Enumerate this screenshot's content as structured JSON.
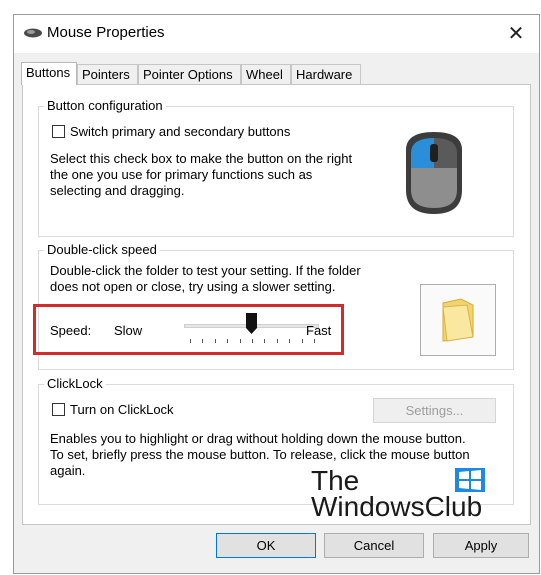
{
  "window": {
    "title": "Mouse Properties",
    "close_glyph": "✕"
  },
  "tabs": [
    {
      "label": "Buttons",
      "active": true
    },
    {
      "label": "Pointers"
    },
    {
      "label": "Pointer Options"
    },
    {
      "label": "Wheel"
    },
    {
      "label": "Hardware"
    }
  ],
  "button_config": {
    "legend": "Button configuration",
    "checkbox_label": "Switch primary and secondary buttons",
    "checked": false,
    "description_lines": [
      "Select this check box to make the button on the right",
      "the one you use for primary functions such as",
      "selecting and dragging."
    ]
  },
  "double_click": {
    "legend": "Double-click speed",
    "description_lines": [
      "Double-click the folder to test your setting. If the folder",
      "does not open or close, try using a slower setting."
    ],
    "speed_label": "Speed:",
    "slow_label": "Slow",
    "fast_label": "Fast",
    "speed_fraction": 0.5,
    "tick_count": 11
  },
  "clicklock": {
    "legend": "ClickLock",
    "checkbox_label": "Turn on ClickLock",
    "checked": false,
    "settings_button": "Settings...",
    "description_lines": [
      "Enables you to highlight or drag without holding down the mouse button.",
      "To set, briefly press the mouse button. To release, click the mouse button",
      "again."
    ]
  },
  "footer": {
    "ok": "OK",
    "cancel": "Cancel",
    "apply": "Apply"
  },
  "watermark": {
    "line1": "The",
    "line2": "WindowsClub"
  },
  "colors": {
    "highlight_border": "#d42a2a",
    "accent": "#0078d7",
    "mouse_button_blue": "#2a8fd8"
  }
}
